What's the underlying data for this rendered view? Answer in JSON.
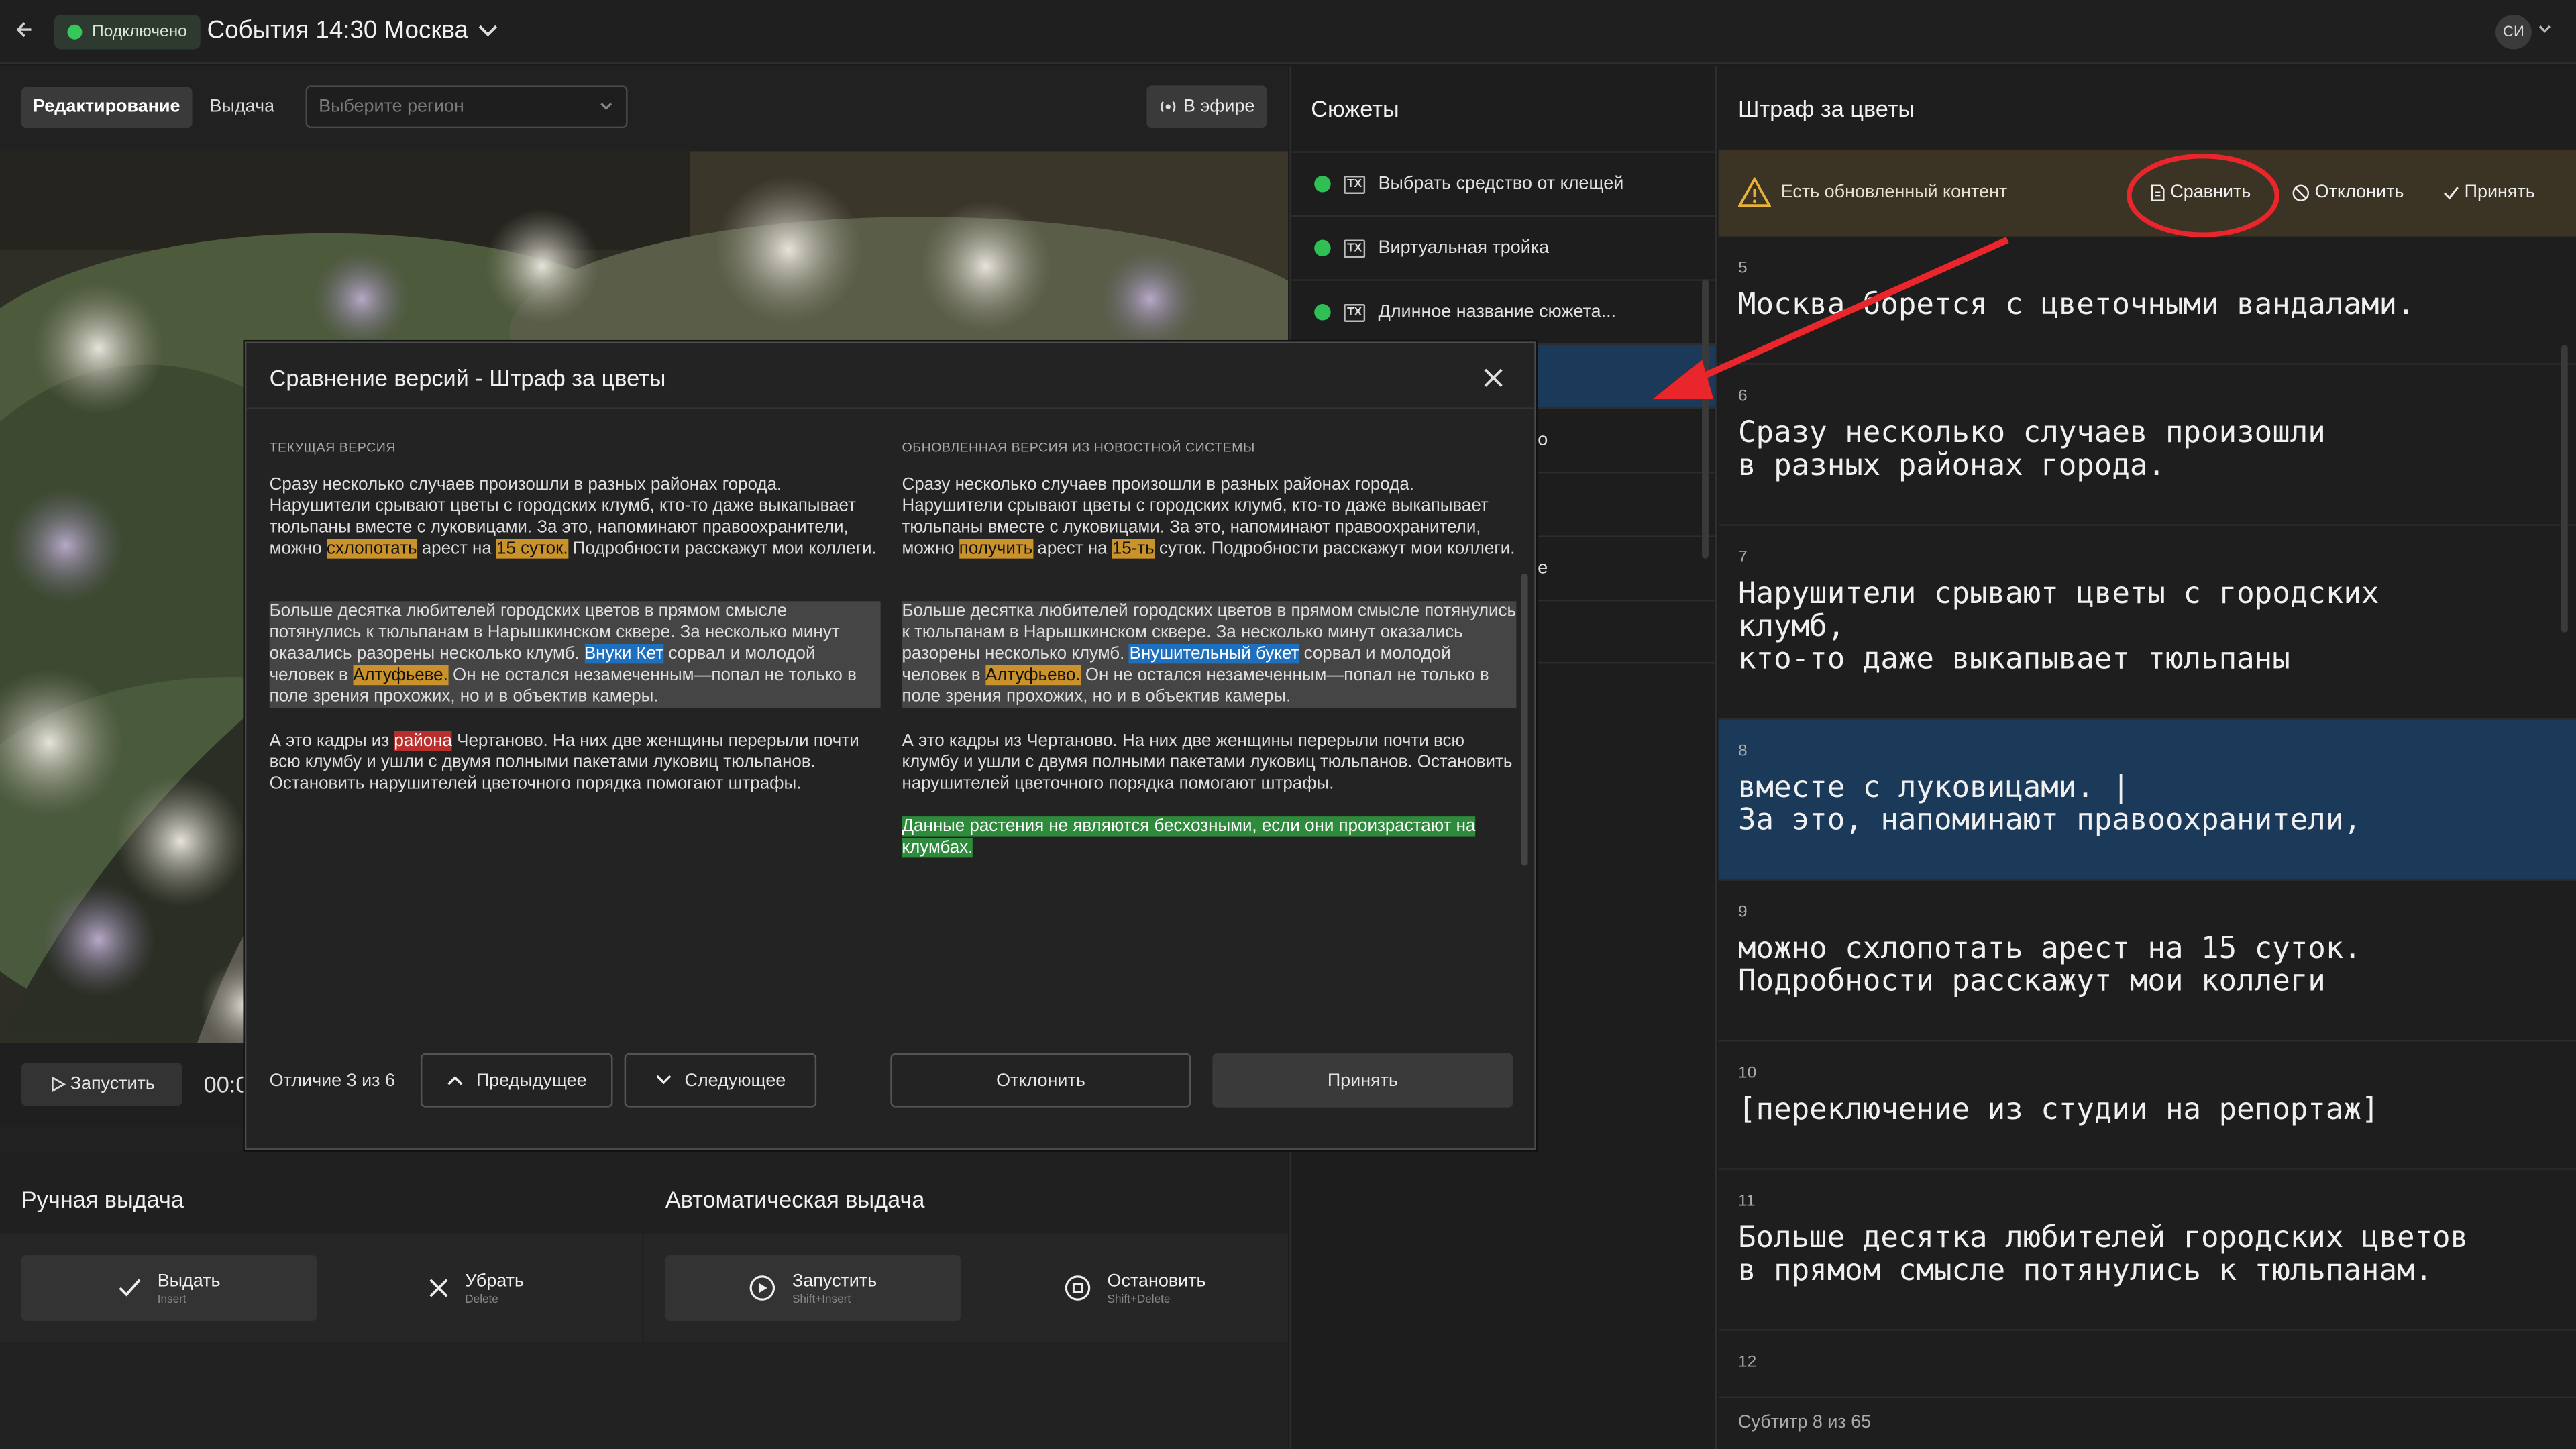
{
  "topbar": {
    "back_icon": "arrow-left-icon",
    "connection_status": "Подключено",
    "title": "События 14:30 Москва",
    "avatar_initials": "СИ"
  },
  "editor": {
    "tabs": [
      "Редактирование",
      "Выдача"
    ],
    "region_placeholder": "Выберите регион",
    "on_air_label": "В эфире",
    "run_label": "Запустить",
    "timecode": "00:0"
  },
  "manual_output": {
    "title": "Ручная выдача",
    "issue": {
      "label": "Выдать",
      "hint": "Insert"
    },
    "remove": {
      "label": "Убрать",
      "hint": "Delete"
    }
  },
  "auto_output": {
    "title": "Автоматическая выдача",
    "start": {
      "label": "Запустить",
      "hint": "Shift+Insert"
    },
    "stop": {
      "label": "Остановить",
      "hint": "Shift+Delete"
    }
  },
  "stories": {
    "title": "Сюжеты",
    "items": [
      {
        "label": "Выбрать средство от клещей",
        "badge": "TX"
      },
      {
        "label": "Виртуальная тройка",
        "badge": "TX"
      },
      {
        "label": "Длинное название сюжета...",
        "badge": "TX"
      }
    ],
    "partial_texts": [
      "о",
      "е"
    ]
  },
  "subtitles": {
    "title": "Штраф за цветы",
    "notice": "Есть обновленный контент",
    "compare_label": "Сравнить",
    "reject_label": "Отклонить",
    "accept_label": "Принять",
    "items": [
      {
        "num": "5",
        "text": "Москва борется с цветочными вандалами."
      },
      {
        "num": "6",
        "text": "Сразу несколько случаев произошли\nв разных районах города."
      },
      {
        "num": "7",
        "text": "Нарушители срывают цветы с городских\nклумб,\nкто-то даже выкапывает тюльпаны"
      },
      {
        "num": "8",
        "text": "вместе с луковицами. |\nЗа это, напоминают правоохранители,",
        "active": true
      },
      {
        "num": "9",
        "text": "можно схлопотать арест на 15 суток.\nПодробности расскажут мои коллеги"
      },
      {
        "num": "10",
        "text": "[переключение из студии на репортаж]"
      },
      {
        "num": "11",
        "text": "Больше десятка любителей городских цветов\nв прямом смысле потянулись к тюльпанам."
      },
      {
        "num": "12",
        "text": ""
      }
    ],
    "footer": "Субтитр 8 из 65"
  },
  "modal": {
    "title": "Сравнение версий - Штраф за цветы",
    "current_label": "ТЕКУЩАЯ ВЕРСИЯ",
    "updated_label": "ОБНОВЛЕННАЯ ВЕРСИЯ ИЗ НОВОСТНОЙ СИСТЕМЫ",
    "current": {
      "p1_a": "Сразу несколько случаев произошли в разных районах города. Нарушители срывают цветы с городских клумб, кто-то даже выкапывает тюльпаны вместе с луковицами. За это, напоминают правоохранители, можно ",
      "p1_h1": "схлопотать",
      "p1_b": " арест на ",
      "p1_h2": "15 суток.",
      "p1_c": " Подробности расскажут мои коллеги.",
      "p2_a": "Больше десятка любителей городских цветов в прямом смысле потянулись к тюльпанам в Нарышкинском сквере. За несколько минут оказались разорены несколько клумб. ",
      "p2_h1": "Внуки Кет",
      "p2_b": " сорвал и молодой человек в ",
      "p2_h2": "Алтуфьеве.",
      "p2_c": " Он не остался незамеченным—попал не только в поле зрения прохожих, но и в объектив камеры.",
      "p3_a": "А это кадры из ",
      "p3_h1": "района",
      "p3_b": " Чертаново. На них две женщины перерыли почти всю клумбу и ушли с двумя полными пакетами луковиц тюльпанов. Остановить нарушителей цветочного порядка помогают штрафы."
    },
    "updated": {
      "p1_a": "Сразу несколько случаев произошли в разных районах города. Нарушители срывают цветы с городских клумб, кто-то даже выкапывает тюльпаны вместе с луковицами. За это, напоминают правоохранители, можно ",
      "p1_h1": "получить",
      "p1_b": " арест на ",
      "p1_h2": "15-ть",
      "p1_c": " суток. Подробности расскажут мои коллеги.",
      "p2_a": "Больше десятка любителей городских цветов в прямом смысле потянулись к тюльпанам в Нарышкинском сквере. За несколько минут оказались разорены несколько клумб. ",
      "p2_h1": "Внушительный букет",
      "p2_b": " сорвал и молодой человек в ",
      "p2_h2": "Алтуфьево.",
      "p2_c": " Он не остался незамеченным—попал не только в поле зрения прохожих, но и в объектив камеры.",
      "p3": "А это кадры из Чертаново. На них две женщины перерыли почти всю клумбу и ушли с двумя полными пакетами луковиц тюльпанов. Остановить нарушителей цветочного порядка помогают штрафы.",
      "p4": "Данные растения не являются бесхозными, если они произрастают на клумбах."
    },
    "diff_counter": "Отличие 3 из 6",
    "prev_label": "Предыдущее",
    "next_label": "Следующее",
    "reject_label": "Отклонить",
    "accept_label": "Принять"
  },
  "colors": {
    "accent_green": "#2fbf53",
    "highlight_yellow": "#c9922a",
    "highlight_blue": "#1f6fbf",
    "highlight_red": "#b8302e",
    "highlight_green": "#2e8b3b",
    "active_subtitle": "#1b3a5a",
    "annotation_red": "#e8262b"
  }
}
